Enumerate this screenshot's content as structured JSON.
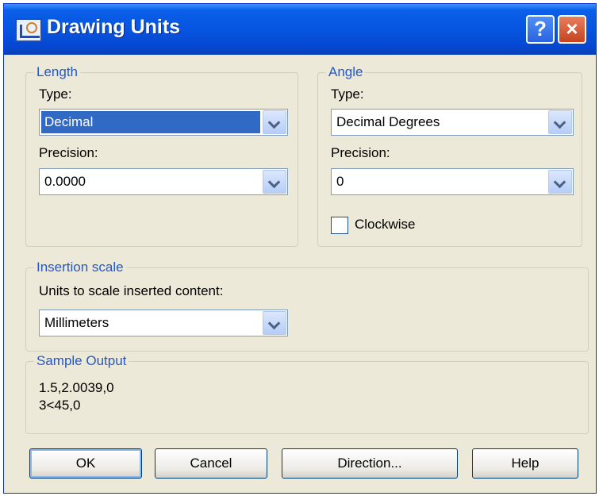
{
  "window": {
    "title": "Drawing Units",
    "help_label": "?",
    "close_label": "×"
  },
  "length": {
    "legend": "Length",
    "type_label": "Type:",
    "type_value": "Decimal",
    "precision_label": "Precision:",
    "precision_value": "0.0000"
  },
  "angle": {
    "legend": "Angle",
    "type_label": "Type:",
    "type_value": "Decimal Degrees",
    "precision_label": "Precision:",
    "precision_value": "0",
    "clockwise_label": "Clockwise",
    "clockwise_checked": false
  },
  "insertion": {
    "legend": "Insertion scale",
    "units_label": "Units to scale inserted content:",
    "units_value": "Millimeters"
  },
  "sample_output": {
    "legend": "Sample Output",
    "line1": "1.5,2.0039,0",
    "line2": "3<45,0"
  },
  "buttons": {
    "ok": "OK",
    "cancel": "Cancel",
    "direction": "Direction...",
    "help": "Help"
  },
  "colors": {
    "titlebar": "#0655e0",
    "dialog_bg": "#ece9d8",
    "legend_text": "#2558c4",
    "selection": "#316ac5"
  }
}
